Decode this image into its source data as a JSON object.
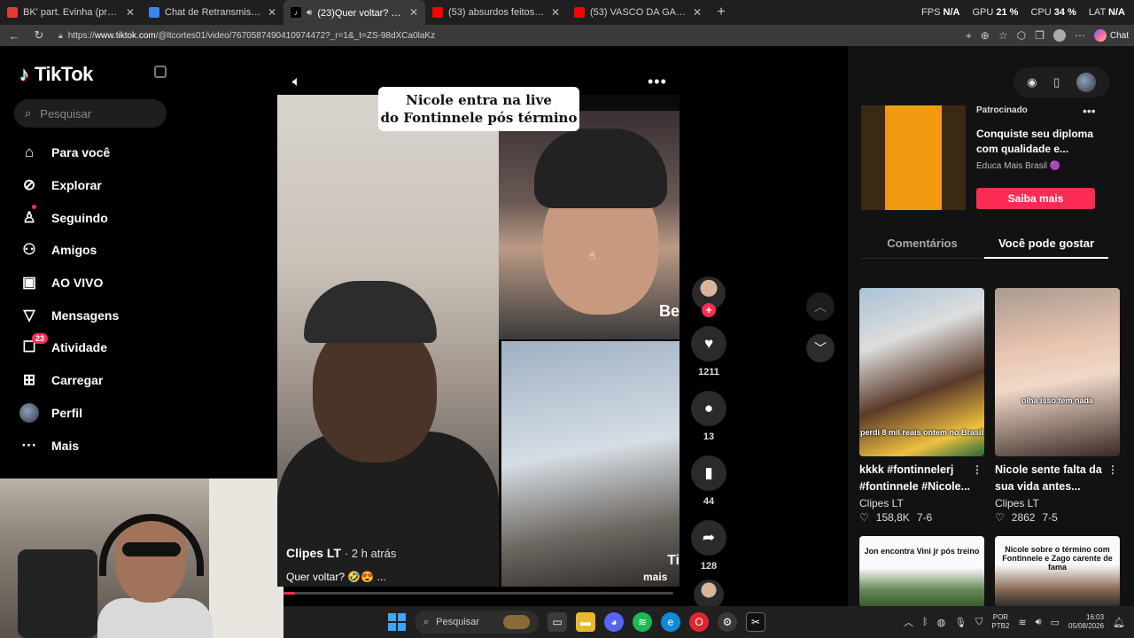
{
  "browser": {
    "tabs": [
      {
        "title": "BK' part. Evinha (prod. Kolo) - Ca",
        "color": "#e53935",
        "active": false
      },
      {
        "title": "Chat de Retransmissão",
        "color": "#3b82f6",
        "active": false
      },
      {
        "title": "(23)Quer voltar? 🤣😍 #fonti",
        "color": "#ffffff",
        "active": true
      },
      {
        "title": "(53) absurdos feitos em lives irl - Y",
        "color": "#ff0000",
        "active": false
      },
      {
        "title": "(53) VASCO DA GAMA E O DIA DO",
        "color": "#ff0000",
        "active": false
      }
    ],
    "perf": {
      "fps_label": "FPS",
      "fps_value": "N/A",
      "gpu_label": "GPU",
      "gpu_value": "21 %",
      "cpu_label": "CPU",
      "cpu_value": "34 %",
      "lat_label": "LAT",
      "lat_value": "N/A"
    },
    "url_scheme": "https://",
    "url_host": "www.tiktok.com",
    "url_path": "/@ltcortes01/video/7670587490410974472?_r=1&_t=ZS-98dXCa0laKz",
    "copilot_label": "Chat"
  },
  "sidebar": {
    "logo": "TikTok",
    "search_placeholder": "Pesquisar",
    "items": [
      {
        "label": "Para você",
        "icon": "home-icon",
        "glyph": "⌂"
      },
      {
        "label": "Explorar",
        "icon": "compass-icon",
        "glyph": "⊘"
      },
      {
        "label": "Seguindo",
        "icon": "following-icon",
        "glyph": "♙"
      },
      {
        "label": "Amigos",
        "icon": "friends-icon",
        "glyph": "⚇"
      },
      {
        "label": "AO VIVO",
        "icon": "live-icon",
        "glyph": "▣"
      },
      {
        "label": "Mensagens",
        "icon": "messages-icon",
        "glyph": "▽"
      },
      {
        "label": "Atividade",
        "icon": "activity-icon",
        "glyph": "☐",
        "badge": "23"
      },
      {
        "label": "Carregar",
        "icon": "upload-icon",
        "glyph": "⊞"
      },
      {
        "label": "Perfil",
        "icon": "profile-avatar",
        "glyph": ""
      },
      {
        "label": "Mais",
        "icon": "more-icon",
        "glyph": "···"
      }
    ]
  },
  "video": {
    "caption_overlay": "Nicole entra na live\ndo Fontinnele pós término",
    "caption_line1": "Nicole entra na live",
    "caption_line2": "do Fontinnele pós término",
    "author": "Clipes LT",
    "time_ago": "· 2 h atrás",
    "description": "Quer voltar? 🤣😍 ...",
    "more": "mais",
    "watermark_top": "Be",
    "watermark_bottom": "Ti",
    "progress": 0.03
  },
  "actions": {
    "likes": "1211",
    "comments": "13",
    "saves": "44",
    "shares": "128"
  },
  "right": {
    "ad": {
      "label": "Patrocinado",
      "title": "Conquiste seu diploma com qualidade e...",
      "brand": "Educa Mais Brasil 🟣",
      "button": "Saiba mais"
    },
    "tabs": [
      "Comentários",
      "Você pode gostar"
    ],
    "cards": [
      {
        "title": "kkkk #fontinnelerj #fontinnele #Nicole...",
        "author": "Clipes LT",
        "likes": "158,8K",
        "date": "7-6",
        "overlay": "perdi 8 mil reais ontem no Brasil"
      },
      {
        "title": "Nicole sente falta da sua vida antes...",
        "author": "Clipes LT",
        "likes": "2862",
        "date": "7-5",
        "overlay": "olha isso tem nada"
      },
      {
        "title": "",
        "author": "",
        "likes": "",
        "date": "",
        "overlay": "Jon encontra Vini jr pós treino"
      },
      {
        "title": "",
        "author": "",
        "likes": "",
        "date": "",
        "overlay": "Nicole sobre o término com Fontinnele e Zago carente de fama"
      }
    ]
  },
  "taskbar": {
    "search": "Pesquisar",
    "lang_top": "POR",
    "lang_bottom": "PTB2",
    "time": "16:03",
    "date": "05/08/2026"
  }
}
